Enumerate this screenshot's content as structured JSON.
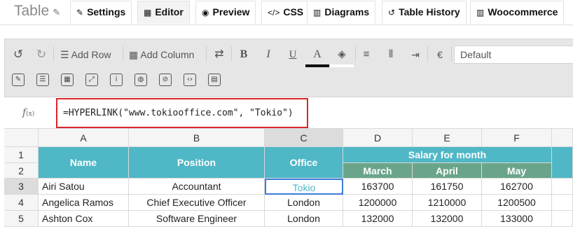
{
  "header": {
    "title": "Table",
    "tabs": [
      {
        "icon": "✎",
        "label": "Settings"
      },
      {
        "icon": "▦",
        "label": "Editor"
      },
      {
        "icon": "◉",
        "label": "Preview"
      },
      {
        "icon": "</>",
        "label": "CSS"
      },
      {
        "icon": "▥",
        "label": "Diagrams"
      },
      {
        "icon": "↺",
        "label": "Table History"
      },
      {
        "icon": "▥",
        "label": "Woocommerce"
      }
    ]
  },
  "toolbar": {
    "add_row": "Add Row",
    "add_column": "Add Column",
    "bold": "B",
    "italic": "I",
    "underline": "U",
    "text_color": "A",
    "currency": "€",
    "font": "Default"
  },
  "formula_bar": {
    "fx_label": "f",
    "fx_sub": "(x)",
    "value": "=HYPERLINK(\"www.tokiooffice.com\", \"Tokio\")"
  },
  "sheet": {
    "columns": [
      "A",
      "B",
      "C",
      "D",
      "E",
      "F"
    ],
    "rows": [
      "1",
      "2",
      "3",
      "4",
      "5"
    ],
    "header": {
      "name": "Name",
      "position": "Position",
      "office": "Office",
      "salary": "Salary for month",
      "months": [
        "March",
        "April",
        "May"
      ]
    },
    "data": [
      [
        "Airi Satou",
        "Accountant",
        "Tokio",
        "163700",
        "161750",
        "162700"
      ],
      [
        "Angelica Ramos",
        "Chief Executive Officer",
        "London",
        "1200000",
        "1210000",
        "1200500"
      ],
      [
        "Ashton Cox",
        "Software Engineer",
        "London",
        "132000",
        "132000",
        "133000"
      ]
    ]
  },
  "colors": {
    "teal": "#4fb7c6",
    "green": "#6aa58b",
    "highlight": "#d9262c",
    "selection": "#3d7ed8"
  }
}
